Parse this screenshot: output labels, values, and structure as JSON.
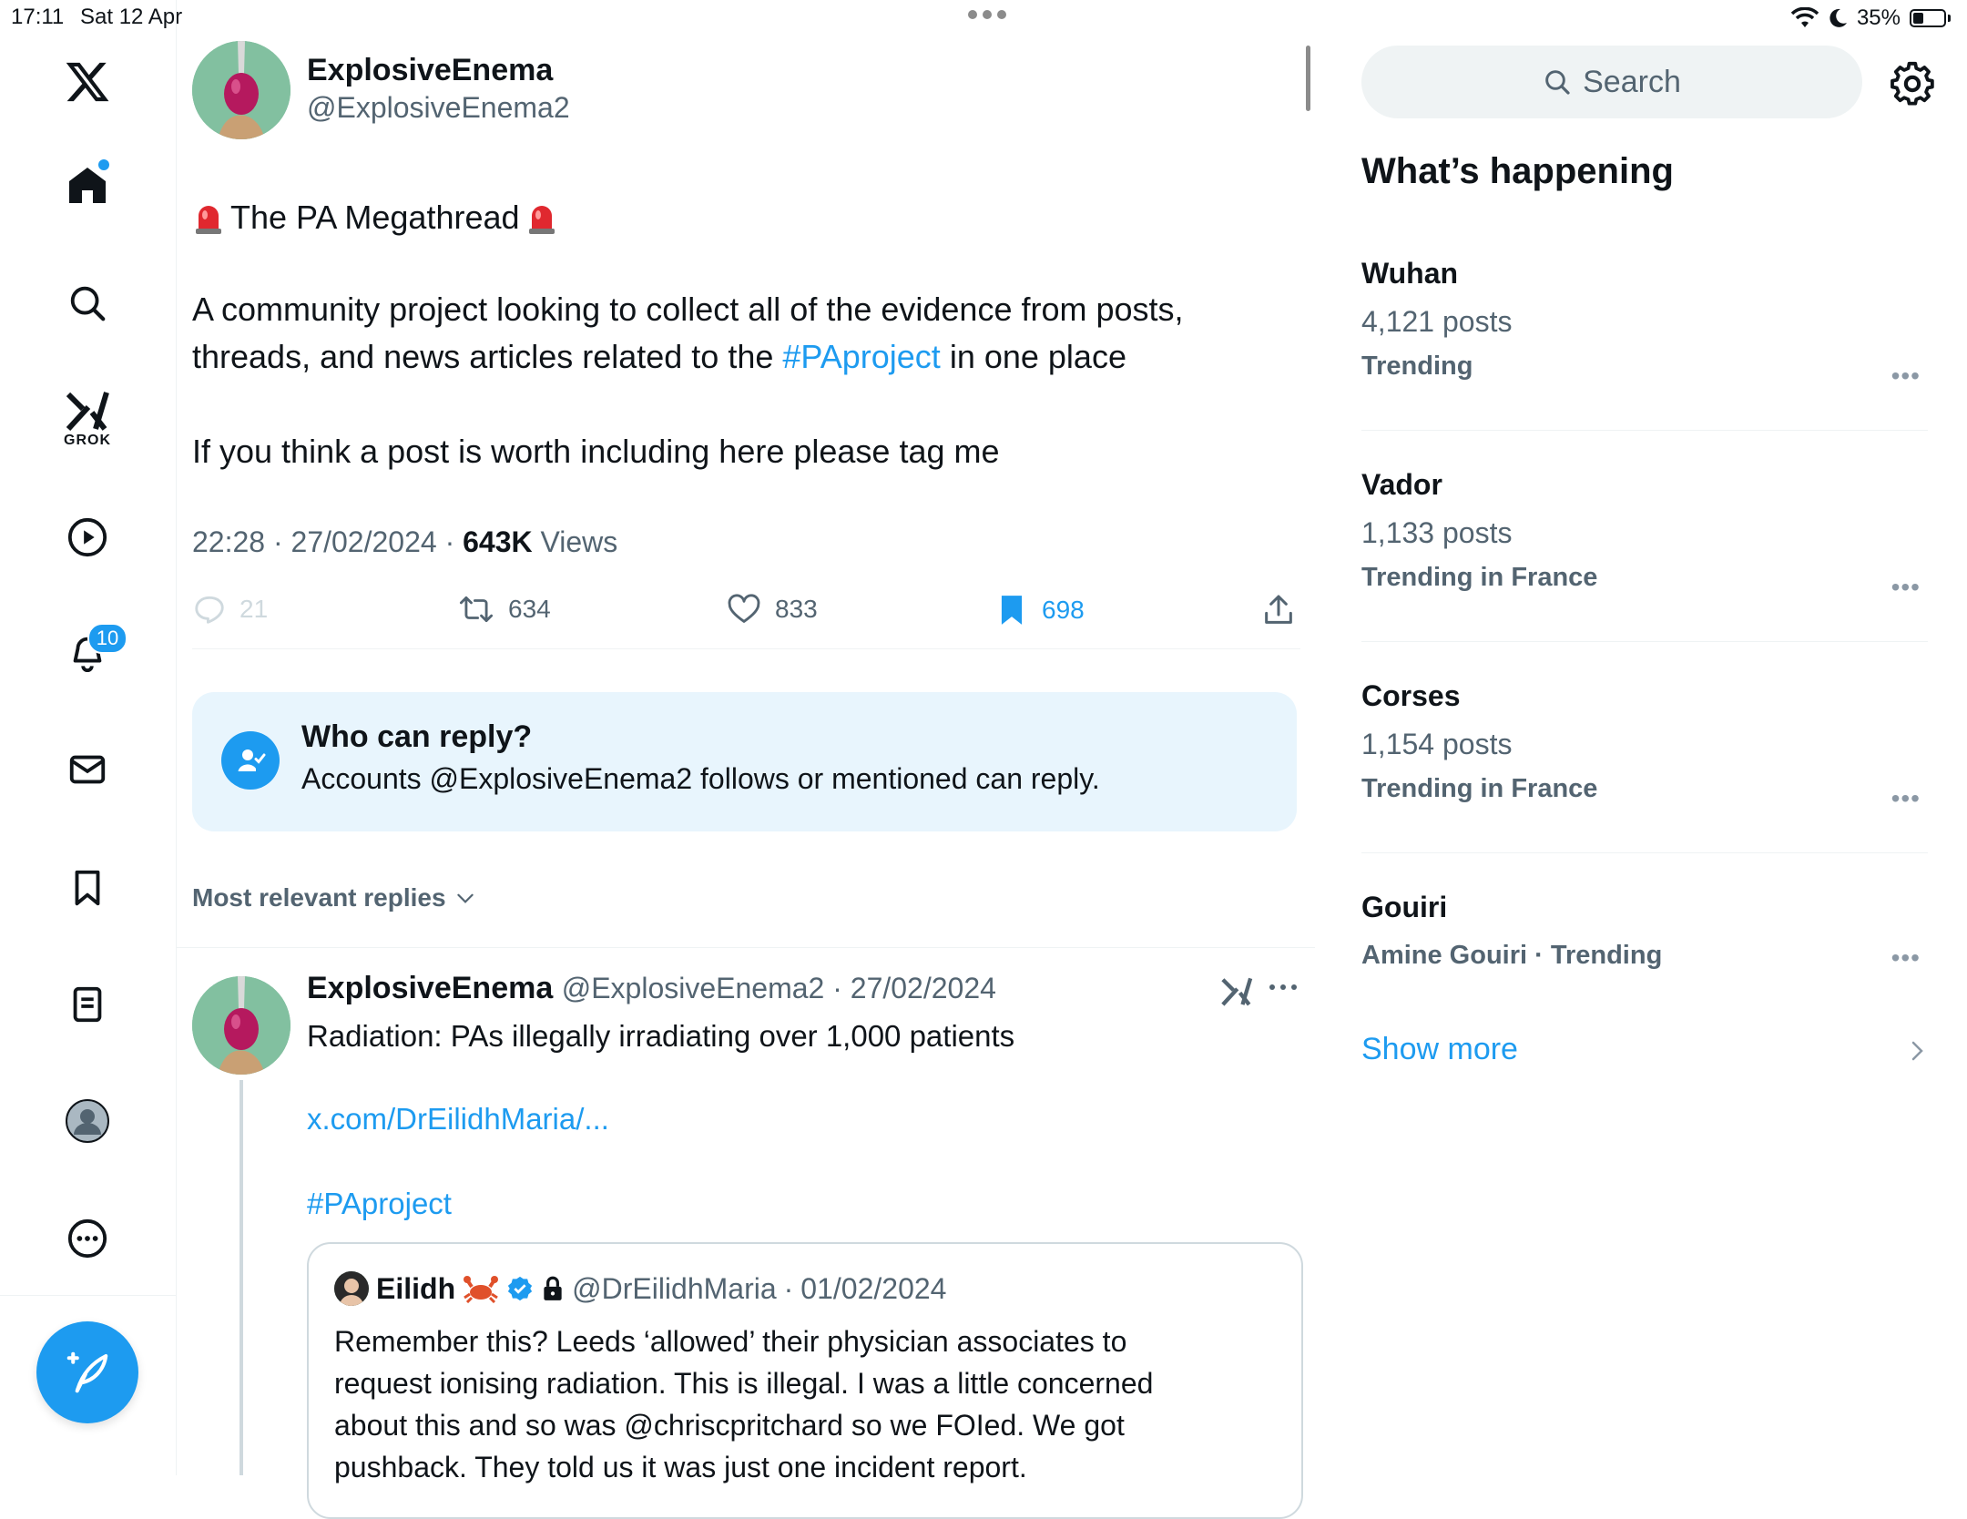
{
  "status_bar": {
    "time": "17:11",
    "date": "Sat 12 Apr",
    "battery": "35%",
    "battery_level": 0.35
  },
  "nav": {
    "logo": "x-logo-icon",
    "grok_label": "GROK",
    "notifications_badge": "10",
    "items": [
      "home-icon",
      "search-icon",
      "grok-icon",
      "video-icon",
      "notifications-icon",
      "messages-icon",
      "bookmarks-icon",
      "lists-icon",
      "profile-icon",
      "more-icon"
    ]
  },
  "tweet": {
    "author_name": "ExplosiveEnema",
    "author_handle": "@ExplosiveEnema2",
    "title": "The PA Megathread",
    "body_1a": "A community project looking to collect all of the evidence from posts,",
    "body_1b": "threads, and news articles related to the ",
    "hashtag": "#PAproject",
    "body_1c": " in one place",
    "body_2": "If you think a post is worth including here please tag me",
    "time": "22:28",
    "date": "27/02/2024",
    "views_count": "643K",
    "views_label": "Views",
    "replies": "21",
    "reposts": "634",
    "likes": "833",
    "bookmarks": "698"
  },
  "who_can_reply": {
    "title": "Who can reply?",
    "text": "Accounts @ExplosiveEnema2 follows or mentioned can reply."
  },
  "replies_sort": "Most relevant replies",
  "reply": {
    "author_name": "ExplosiveEnema",
    "author_handle": "@ExplosiveEnema2",
    "date": "27/02/2024",
    "text": "Radiation: PAs illegally irradiating over 1,000 patients",
    "link": "x.com/DrEilidhMaria/...",
    "hashtag": "#PAproject",
    "quote": {
      "author_name": "Eilidh",
      "author_handle": "@DrEilidhMaria",
      "date": "01/02/2024",
      "line_1": "Remember this? Leeds ‘allowed’ their physician associates to",
      "line_2": "request ionising radiation. This is illegal. I was a little concerned",
      "line_3": "about this and so was @chriscpritchard so we FOIed. We got",
      "line_4": "pushback. They told us it was just one incident report."
    }
  },
  "sidebar": {
    "search_placeholder": "Search",
    "whats_happening": "What’s happening",
    "trends": [
      {
        "name": "Wuhan",
        "count": "4,121 posts",
        "context": "Trending"
      },
      {
        "name": "Vador",
        "count": "1,133 posts",
        "context": "Trending in France"
      },
      {
        "name": "Corses",
        "count": "1,154 posts",
        "context": "Trending in France"
      },
      {
        "name": "Gouiri",
        "context": "Amine Gouiri · Trending"
      }
    ],
    "show_more": "Show more"
  },
  "colors": {
    "accent": "#1d9bf0",
    "text": "#0f1419",
    "secondary": "#536471",
    "who_bg": "#e8f5fd"
  }
}
